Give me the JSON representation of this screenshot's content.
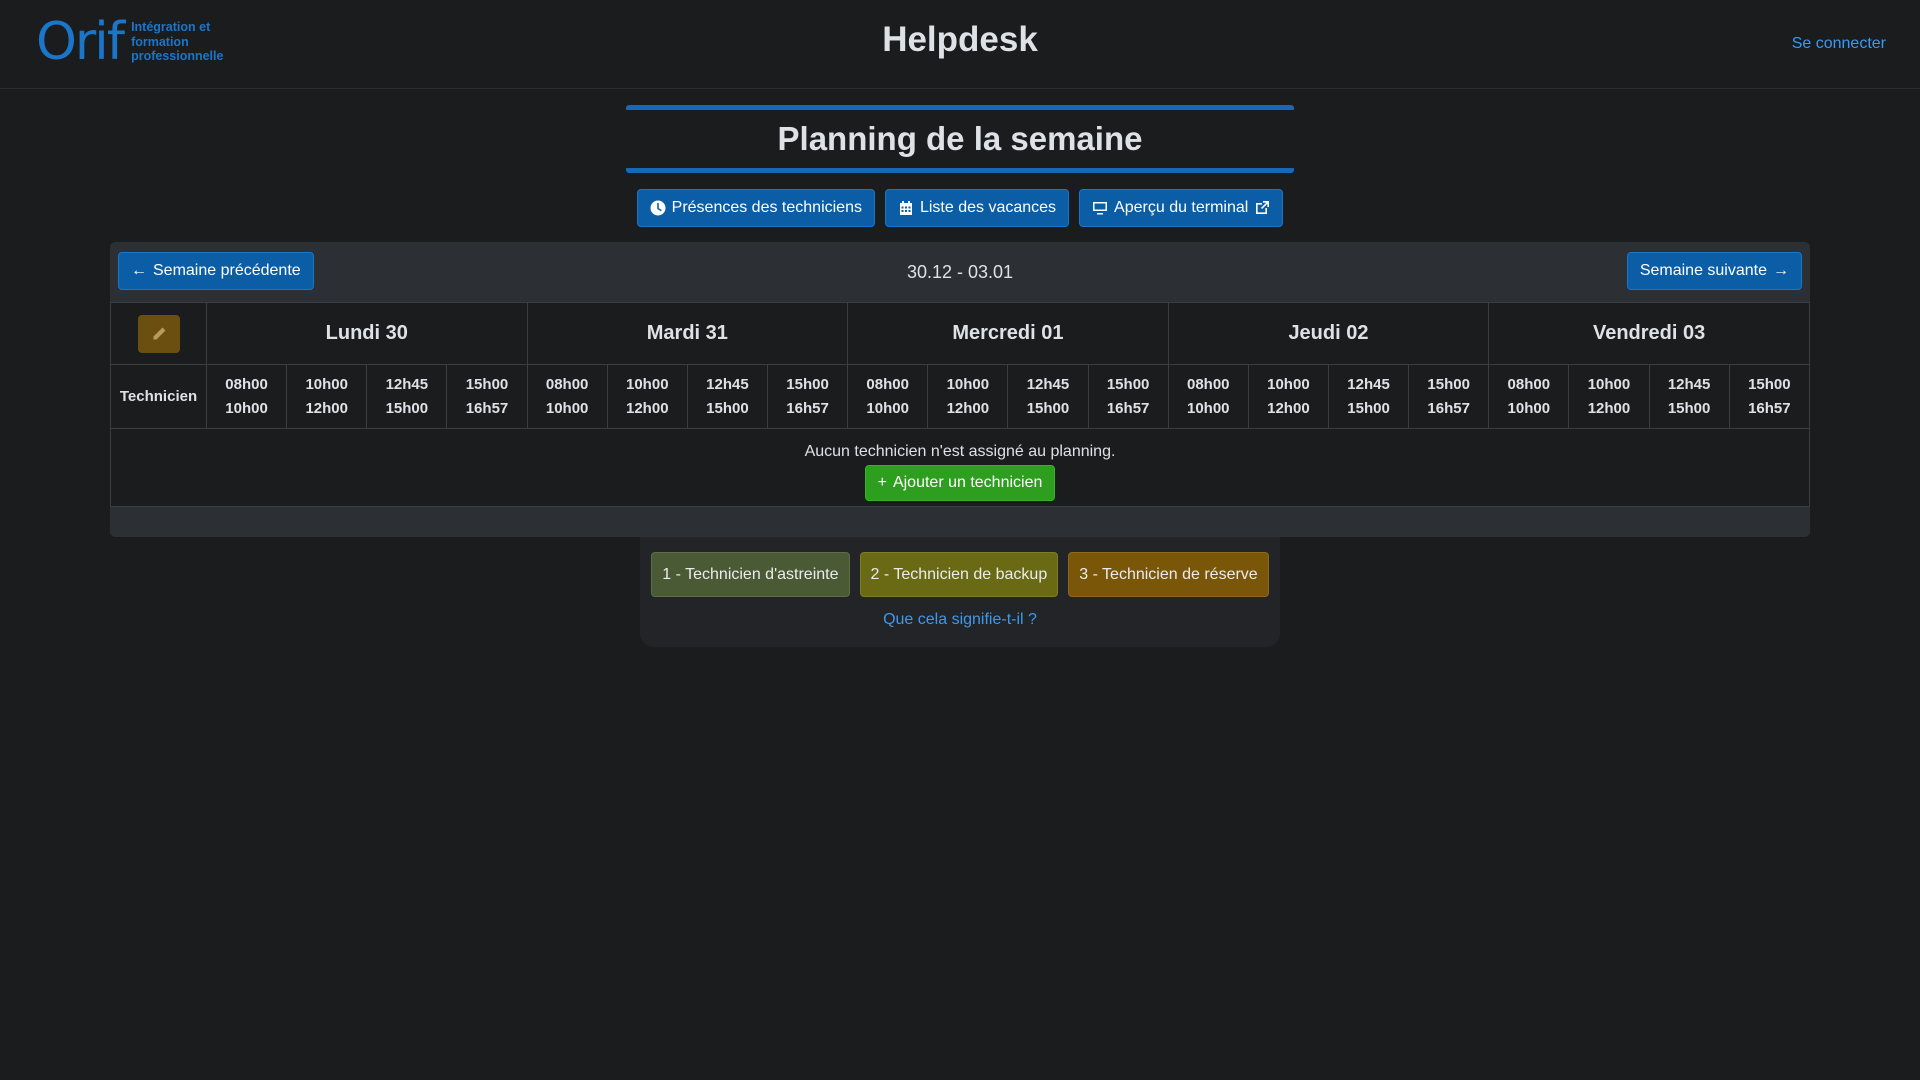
{
  "header": {
    "logo_word": "Orif",
    "logo_tagline": "Intégration et formation professionnelle",
    "title": "Helpdesk",
    "login_label": "Se connecter"
  },
  "page": {
    "title": "Planning de la semaine",
    "actions": [
      {
        "label": "Présences des techniciens",
        "icon": "clock-icon"
      },
      {
        "label": "Liste des vacances",
        "icon": "calendar-icon"
      },
      {
        "label": "Aperçu du terminal",
        "icon": "monitor-icon",
        "trailing_icon": "external-link-icon"
      }
    ]
  },
  "planning": {
    "prev_label": "Semaine précédente",
    "next_label": "Semaine suivante",
    "week_range": "30.12 - 03.01",
    "technician_header": "Technicien",
    "days": [
      "Lundi 30",
      "Mardi 31",
      "Mercredi 01",
      "Jeudi 02",
      "Vendredi 03"
    ],
    "slots": [
      {
        "start": "08h00",
        "end": "10h00"
      },
      {
        "start": "10h00",
        "end": "12h00"
      },
      {
        "start": "12h45",
        "end": "15h00"
      },
      {
        "start": "15h00",
        "end": "16h57"
      }
    ],
    "empty_message": "Aucun technicien n'est assigné au planning.",
    "add_label": "Ajouter un technicien"
  },
  "legend": {
    "badges": [
      "1 - Technicien d'astreinte",
      "2 - Technicien de backup",
      "3 - Technicien de réserve"
    ],
    "colors": [
      "#4a5a34",
      "#6a6a14",
      "#7a5609"
    ],
    "help_link": "Que cela signifie-t-il ?"
  }
}
